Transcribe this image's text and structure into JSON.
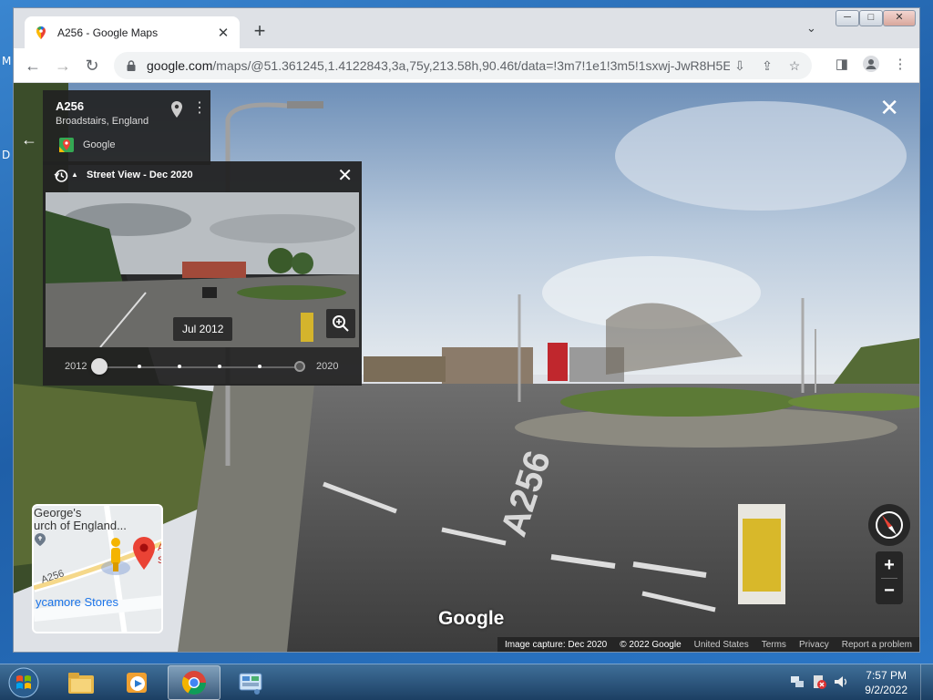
{
  "desktop": {
    "letters": [
      "M",
      "D"
    ]
  },
  "browser": {
    "tab_title": "A256 - Google Maps",
    "tab_close": "✕",
    "new_tab": "+",
    "tab_search": "⌄",
    "url_host": "google.com",
    "url_rest": "/maps/@51.361245,1.4122843,3a,75y,213.58h,90.46t/data=!3m7!1e1!3m5!1sxwj-JwR8H5EI...",
    "win_min": "─",
    "win_max": "□",
    "win_close": "✕"
  },
  "info_card": {
    "title": "A256",
    "subtitle": "Broadstairs, England",
    "source": "Google"
  },
  "time_machine": {
    "title": "Street View - Dec 2020",
    "date_badge": "Jul 2012",
    "start_year": "2012",
    "end_year": "2020",
    "selected_index": 0,
    "stops": 6
  },
  "minimap": {
    "line1": "George's",
    "line2": "urch of England...",
    "road": "A256",
    "store": "ycamore Stores",
    "pin_letter_1": "A",
    "pin_letter_2": "S"
  },
  "controls": {
    "zoom_in": "+",
    "zoom_out": "−",
    "close": "✕"
  },
  "watermark": "Google",
  "footer": {
    "capture": "Image capture: Dec 2020",
    "copyright": "© 2022 Google",
    "region": "United States",
    "terms": "Terms",
    "privacy": "Privacy",
    "report": "Report a problem"
  },
  "taskbar": {
    "time": "7:57 PM",
    "date": "9/2/2022"
  },
  "colors": {
    "panel": "#222222",
    "accent_blue": "#1a73e8",
    "pin_red": "#ea4335"
  }
}
